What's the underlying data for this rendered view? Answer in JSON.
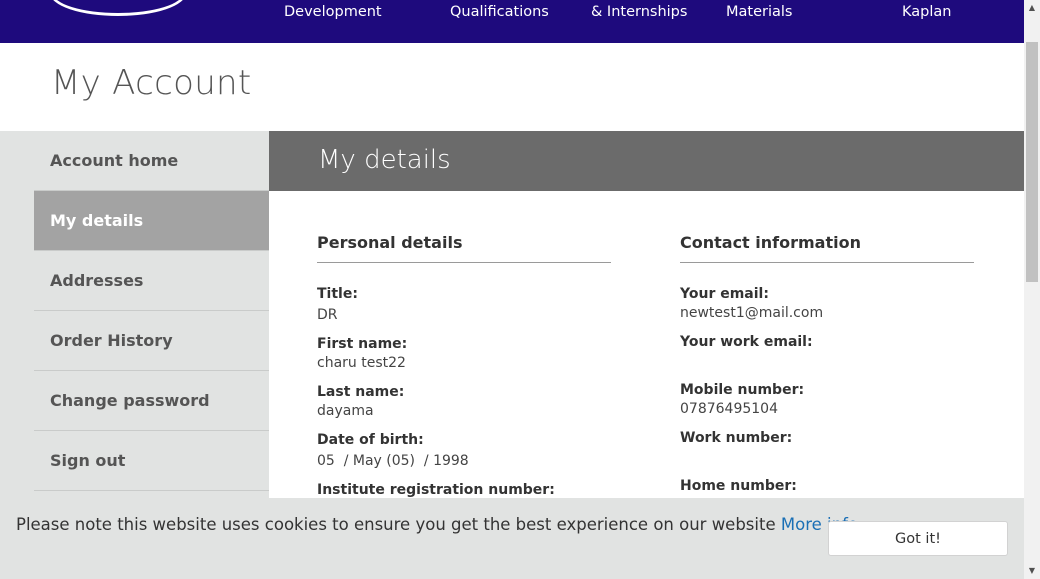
{
  "nav": {
    "items": [
      {
        "label": "Development"
      },
      {
        "label": "Qualifications"
      },
      {
        "label": "& Internships"
      },
      {
        "label": "Materials"
      },
      {
        "label": "Kaplan"
      }
    ]
  },
  "page_title": "My Account",
  "sidebar": {
    "items": [
      {
        "label": "Account home",
        "active": false
      },
      {
        "label": "My details",
        "active": true
      },
      {
        "label": "Addresses",
        "active": false
      },
      {
        "label": "Order History",
        "active": false
      },
      {
        "label": "Change password",
        "active": false
      },
      {
        "label": "Sign out",
        "active": false
      }
    ]
  },
  "main": {
    "title": "My details",
    "personal": {
      "heading": "Personal details",
      "title_label": "Title:",
      "title_value": "DR",
      "first_name_label": "First name:",
      "first_name_value": "charu test22",
      "last_name_label": "Last name:",
      "last_name_value": "dayama",
      "dob_label": "Date of birth:",
      "dob_value": "05  / May (05)  / 1998",
      "institute_label": "Institute registration number:"
    },
    "contact": {
      "heading": "Contact information",
      "email_label": "Your email:",
      "email_value": "newtest1@mail.com",
      "work_email_label": "Your work email:",
      "mobile_label": "Mobile number:",
      "mobile_value": "07876495104",
      "work_number_label": "Work number:",
      "home_number_label": "Home number:"
    }
  },
  "cookie": {
    "text": "Please note this website uses cookies to ensure you get the best experience on our website",
    "link": "More info",
    "button": "Got it!"
  },
  "colors": {
    "nav_bg": "#1e0a7d",
    "sidebar_bg": "#e1e3e2",
    "sidebar_active": "#a3a3a3",
    "header_bg": "#6b6b6b",
    "link": "#1a6fb5"
  },
  "icons": {
    "scroll_up": "▲",
    "scroll_down": "▼"
  }
}
